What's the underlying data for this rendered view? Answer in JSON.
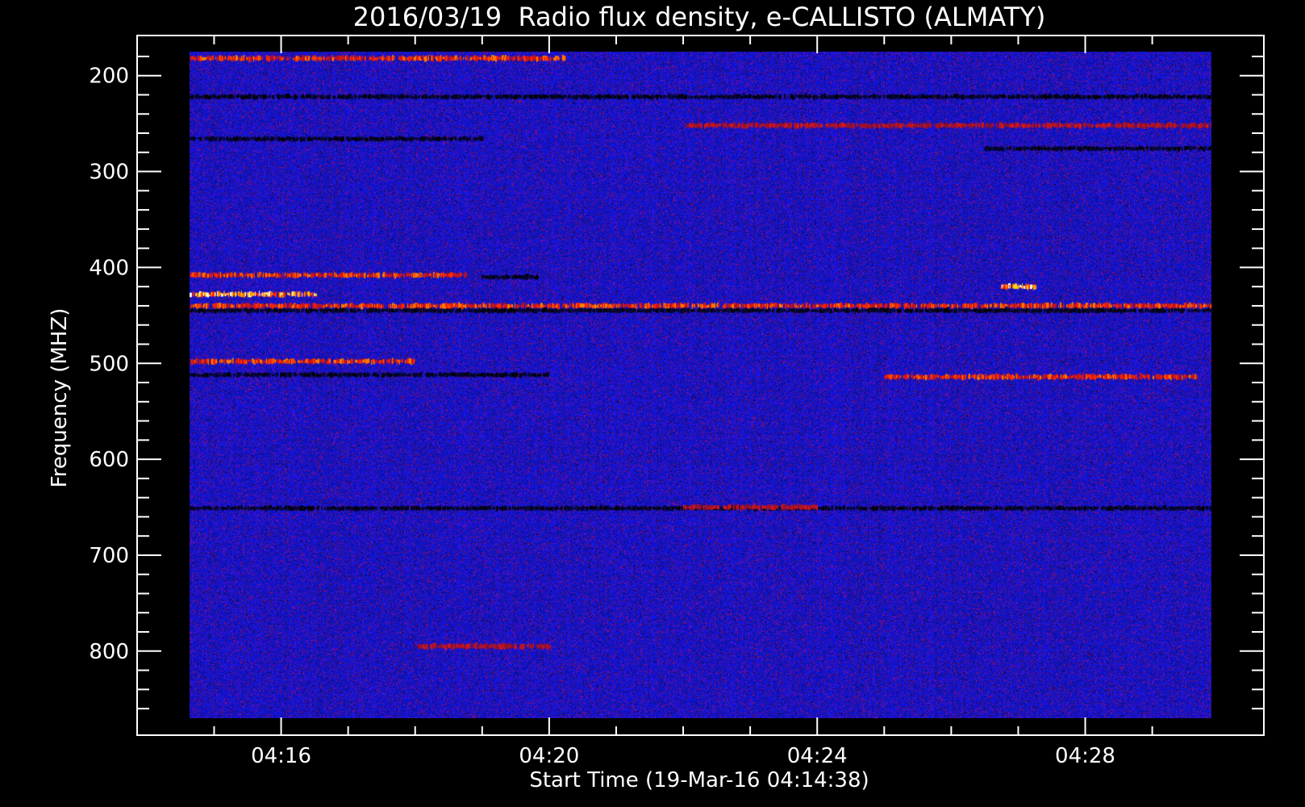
{
  "chart_data": {
    "type": "heatmap",
    "title": "2016/03/19  Radio flux density, e-CALLISTO (ALMATY)",
    "xlabel": "Start Time (19-Mar-16 04:14:38)",
    "ylabel": "Frequency (MHZ)",
    "x_unit": "time HH:MM (UT)",
    "y_unit": "MHz",
    "xlim": [
      "04:14:38",
      "04:29:53"
    ],
    "ylim": [
      175,
      870
    ],
    "y_inverted": true,
    "x_ticks": [
      "04:16",
      "04:20",
      "04:24",
      "04:28"
    ],
    "y_ticks": [
      200,
      300,
      400,
      500,
      600,
      700,
      800
    ],
    "colormap": [
      "#000000",
      "#0a0aa8",
      "#1a1aff",
      "#b3122a",
      "#ff2a00",
      "#ffd21a",
      "#ffffff"
    ],
    "background": "#2a1ee6",
    "grid": false,
    "features": [
      {
        "kind": "emission",
        "freq_mhz": 182,
        "t_start": "04:14:38",
        "t_end": "04:20:15",
        "level": "high"
      },
      {
        "kind": "absorption",
        "freq_mhz": 222,
        "t_start": "04:14:38",
        "t_end": "04:29:53",
        "level": "low"
      },
      {
        "kind": "absorption",
        "freq_mhz": 266,
        "t_start": "04:14:38",
        "t_end": "04:19:00",
        "level": "low"
      },
      {
        "kind": "emission",
        "freq_mhz": 252,
        "t_start": "04:22:00",
        "t_end": "04:29:53",
        "level": "medium"
      },
      {
        "kind": "absorption",
        "freq_mhz": 276,
        "t_start": "04:26:30",
        "t_end": "04:29:53",
        "level": "low"
      },
      {
        "kind": "emission",
        "freq_mhz": 408,
        "t_start": "04:14:38",
        "t_end": "04:18:45",
        "level": "high"
      },
      {
        "kind": "absorption",
        "freq_mhz": 410,
        "t_start": "04:19:00",
        "t_end": "04:19:50",
        "level": "low"
      },
      {
        "kind": "emission",
        "freq_mhz": 428,
        "t_start": "04:14:38",
        "t_end": "04:16:30",
        "level": "very-high"
      },
      {
        "kind": "emission",
        "freq_mhz": 440,
        "t_start": "04:14:38",
        "t_end": "04:29:53",
        "level": "high"
      },
      {
        "kind": "absorption",
        "freq_mhz": 445,
        "t_start": "04:14:38",
        "t_end": "04:29:53",
        "level": "low"
      },
      {
        "kind": "emission",
        "freq_mhz": 420,
        "t_start": "04:26:45",
        "t_end": "04:27:15",
        "level": "very-high"
      },
      {
        "kind": "emission",
        "freq_mhz": 498,
        "t_start": "04:14:38",
        "t_end": "04:18:00",
        "level": "high"
      },
      {
        "kind": "emission",
        "freq_mhz": 514,
        "t_start": "04:25:00",
        "t_end": "04:29:40",
        "level": "high"
      },
      {
        "kind": "absorption",
        "freq_mhz": 512,
        "t_start": "04:14:38",
        "t_end": "04:20:00",
        "level": "low"
      },
      {
        "kind": "absorption",
        "freq_mhz": 651,
        "t_start": "04:14:38",
        "t_end": "04:29:53",
        "level": "low"
      },
      {
        "kind": "emission",
        "freq_mhz": 650,
        "t_start": "04:22:00",
        "t_end": "04:24:00",
        "level": "medium"
      },
      {
        "kind": "emission",
        "freq_mhz": 795,
        "t_start": "04:18:00",
        "t_end": "04:20:00",
        "level": "medium"
      }
    ]
  }
}
